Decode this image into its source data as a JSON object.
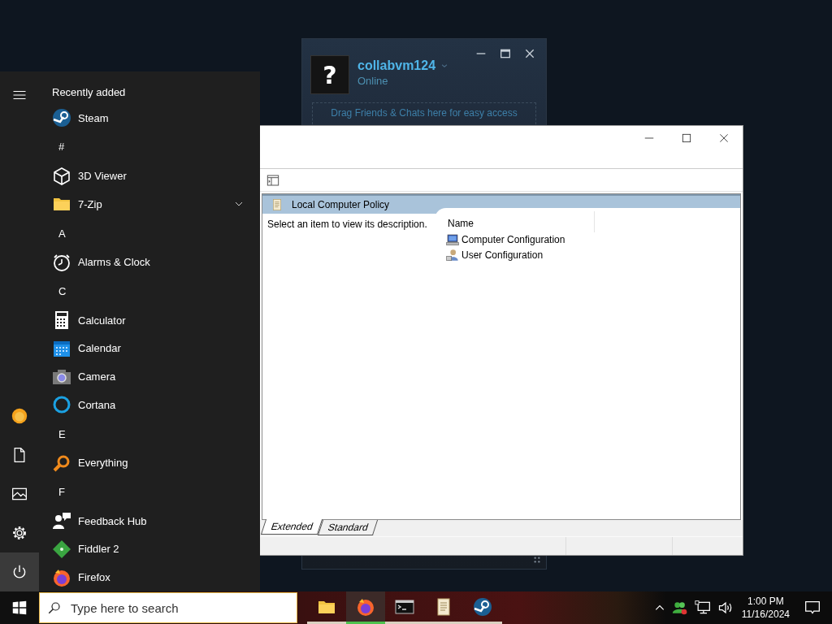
{
  "steam_window": {
    "avatar": "?",
    "username": "collabvm124",
    "status": "Online",
    "drop_hint": "Drag Friends & Chats here for easy access"
  },
  "editor_window": {
    "header": "Local Computer Policy",
    "description": "Select an item to view its description.",
    "columns": [
      "Name"
    ],
    "items": [
      {
        "label": "Computer Configuration",
        "kind": "computer"
      },
      {
        "label": "User Configuration",
        "kind": "user"
      }
    ],
    "tabs": [
      {
        "label": "Extended",
        "selected": true
      },
      {
        "label": "Standard",
        "selected": false
      }
    ]
  },
  "start_menu": {
    "rail": [
      {
        "kind": "avatar"
      },
      {
        "kind": "documents"
      },
      {
        "kind": "pictures"
      },
      {
        "kind": "settings"
      },
      {
        "kind": "power"
      }
    ],
    "section_title": "Recently added",
    "apps": [
      {
        "kind": "app",
        "label": "Steam",
        "expandable": false
      },
      {
        "kind": "letter",
        "label": "#"
      },
      {
        "kind": "app",
        "label": "3D Viewer",
        "expandable": false
      },
      {
        "kind": "app",
        "label": "7-Zip",
        "expandable": true
      },
      {
        "kind": "letter",
        "label": "A"
      },
      {
        "kind": "app",
        "label": "Alarms & Clock",
        "expandable": false
      },
      {
        "kind": "letter",
        "label": "C"
      },
      {
        "kind": "app",
        "label": "Calculator",
        "expandable": false
      },
      {
        "kind": "app",
        "label": "Calendar",
        "expandable": false
      },
      {
        "kind": "app",
        "label": "Camera",
        "expandable": false
      },
      {
        "kind": "app",
        "label": "Cortana",
        "expandable": false
      },
      {
        "kind": "letter",
        "label": "E"
      },
      {
        "kind": "app",
        "label": "Everything",
        "expandable": false
      },
      {
        "kind": "letter",
        "label": "F"
      },
      {
        "kind": "app",
        "label": "Feedback Hub",
        "expandable": false
      },
      {
        "kind": "app",
        "label": "Fiddler 2",
        "expandable": false
      },
      {
        "kind": "app",
        "label": "Firefox",
        "expandable": false
      }
    ]
  },
  "taskbar": {
    "search": {
      "placeholder": "Type here to search"
    },
    "apps": [
      {
        "selected": false
      },
      {
        "selected": true
      },
      {
        "selected": false
      },
      {
        "selected": false
      },
      {
        "selected": false
      }
    ],
    "time": "1:00 PM",
    "date": "11/16/2024"
  }
}
